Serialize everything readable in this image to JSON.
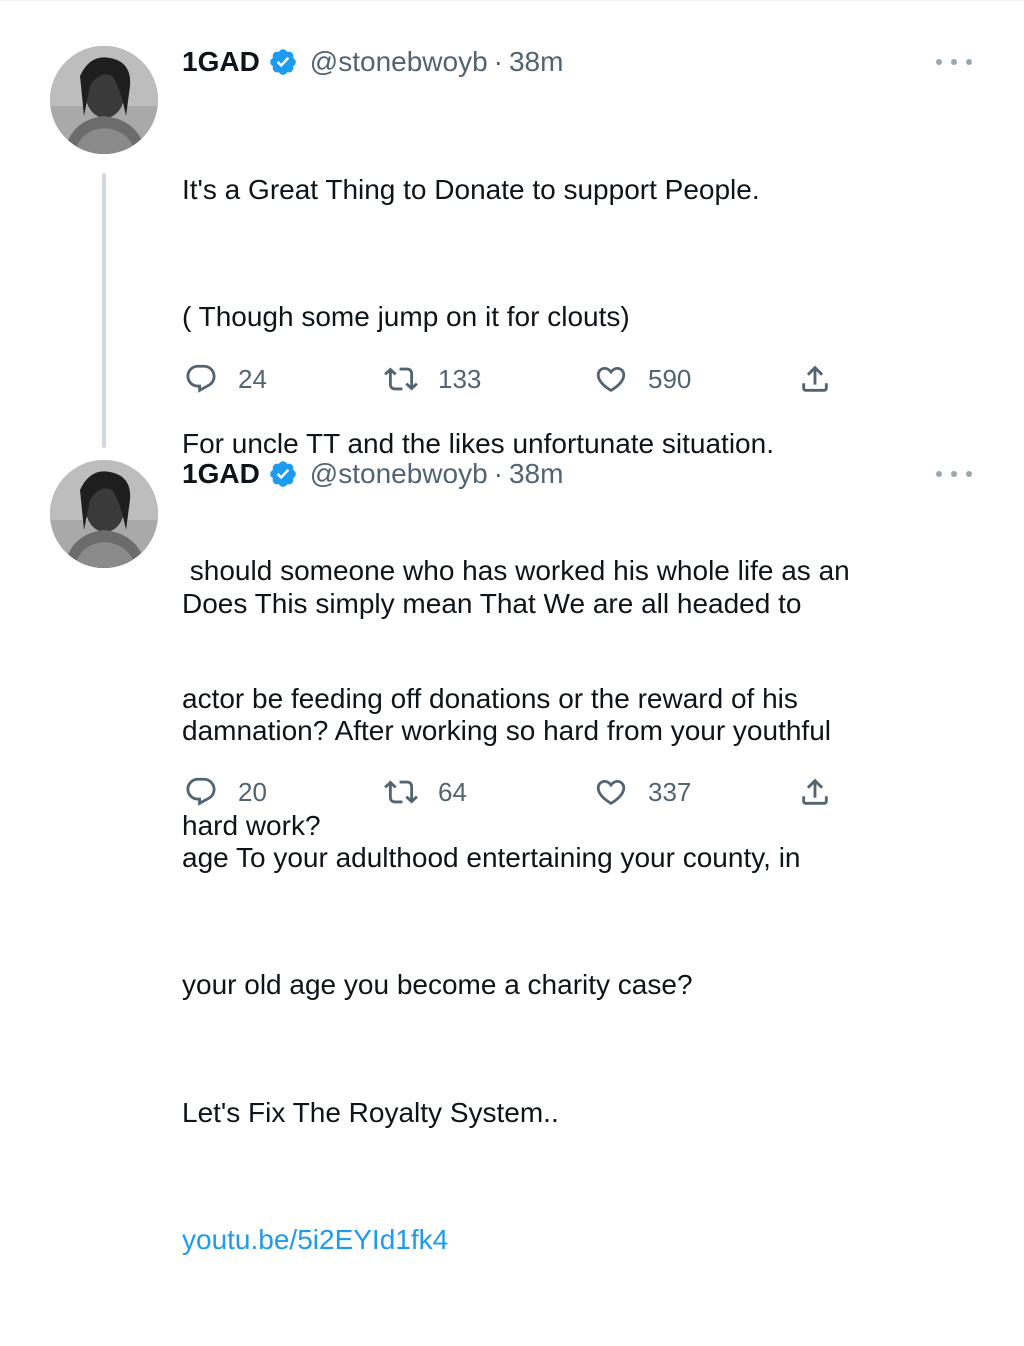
{
  "tweets": [
    {
      "name": "1GAD",
      "handle": "@stonebwoyb",
      "separator": "·",
      "time": "38m",
      "lines": [
        "It's a Great Thing to Donate to support People.",
        "( Though some jump on it for clouts)",
        "For uncle TT and the likes unfortunate situation.",
        " should someone who has worked his whole life as an",
        "actor be feeding off donations or the reward of his",
        "hard work?"
      ],
      "link": "",
      "replies": "24",
      "retweets": "133",
      "likes": "590"
    },
    {
      "name": "1GAD",
      "handle": "@stonebwoyb",
      "separator": "·",
      "time": "38m",
      "lines": [
        "Does This simply mean That We are all headed to",
        "damnation? After working so hard from your youthful",
        "age To your adulthood entertaining your county, in",
        "your old age you become a charity case?",
        "Let's Fix The Royalty System.."
      ],
      "link": "youtu.be/5i2EYId1fk4",
      "replies": "20",
      "retweets": "64",
      "likes": "337"
    }
  ],
  "icons": {
    "verified": "verified-badge-icon",
    "more": "more-options-icon",
    "reply": "reply-icon",
    "retweet": "retweet-icon",
    "like": "heart-icon",
    "share": "share-icon"
  },
  "colors": {
    "verified_badge": "#1d9bf0",
    "link": "#1d9bf0",
    "secondary_text": "#536471",
    "thread_line": "#cfd9de"
  }
}
